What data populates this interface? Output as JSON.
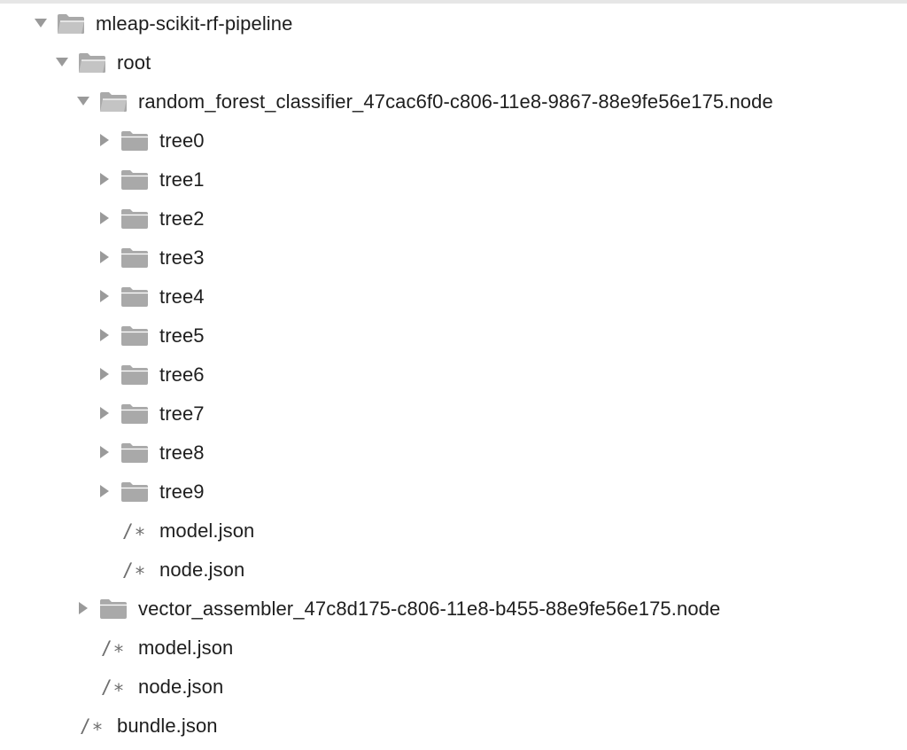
{
  "icons": {
    "folder_closed": "folder-icon",
    "folder_open": "folder-open-icon",
    "file": "json-file-icon",
    "expanded": "chevron-down-icon",
    "collapsed": "chevron-right-icon"
  },
  "colors": {
    "folder": "#a9a9a9",
    "disclosure": "#9a9a9a",
    "file_glyph": "#6e6e6e",
    "text": "#1e1e1e"
  },
  "file_glyph_text": "/∗",
  "tree": {
    "root_folder": "mleap-scikit-rf-pipeline",
    "root_dir": "root",
    "rf_node": "random_forest_classifier_47cac6f0-c806-11e8-9867-88e9fe56e175.node",
    "trees": [
      "tree0",
      "tree1",
      "tree2",
      "tree3",
      "tree4",
      "tree5",
      "tree6",
      "tree7",
      "tree8",
      "tree9"
    ],
    "rf_model_json": "model.json",
    "rf_node_json": "node.json",
    "va_node": "vector_assembler_47c8d175-c806-11e8-b455-88e9fe56e175.node",
    "root_model_json": "model.json",
    "root_node_json": "node.json",
    "bundle_json": "bundle.json"
  }
}
